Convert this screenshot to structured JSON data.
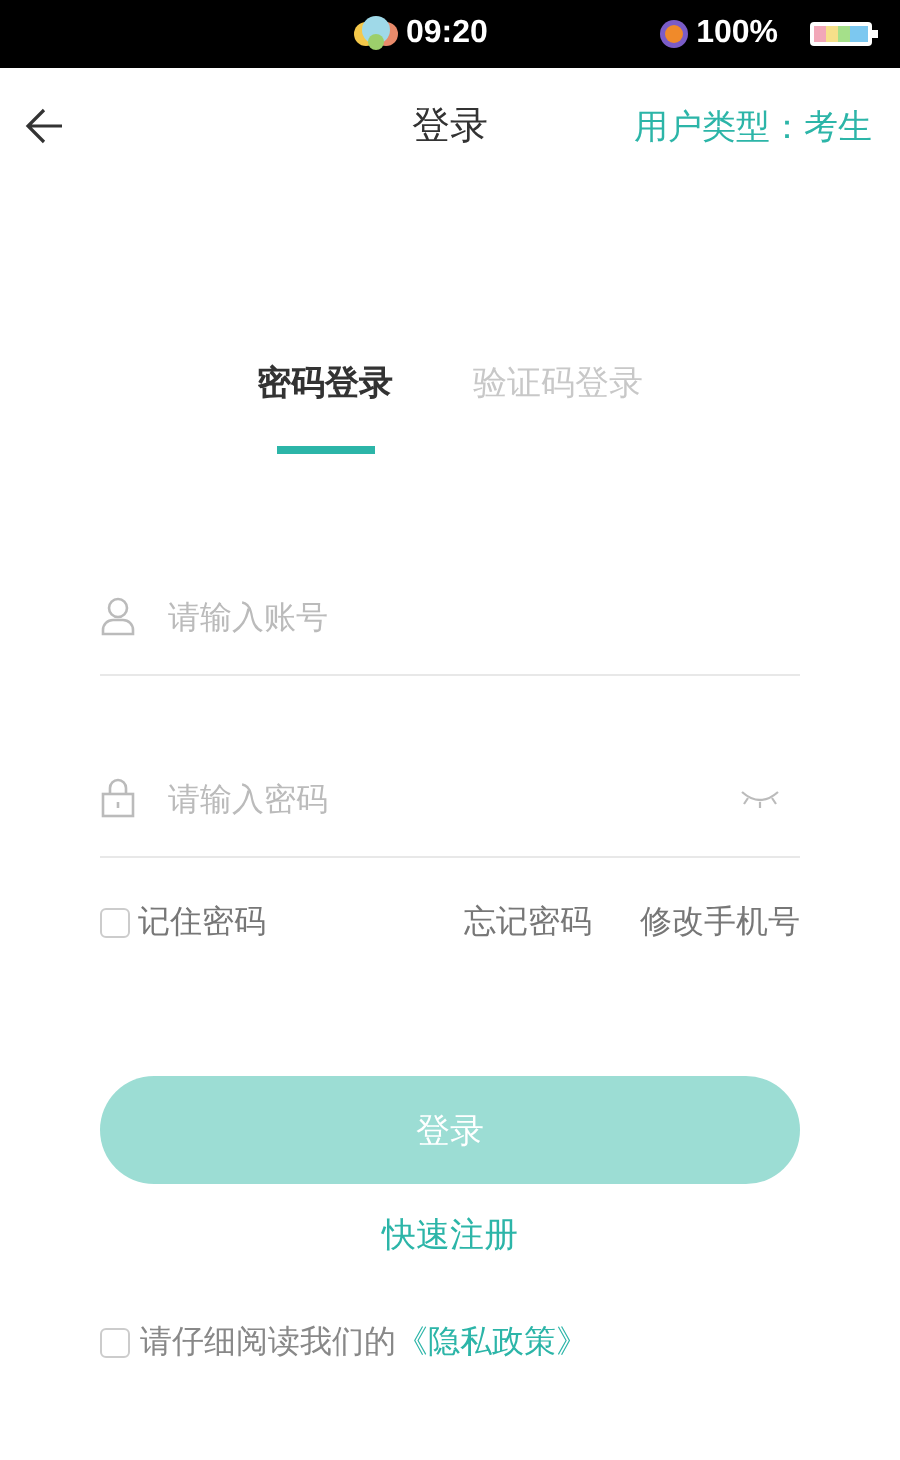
{
  "status_bar": {
    "time": "09:20",
    "battery": "100%"
  },
  "header": {
    "title": "登录",
    "user_type": "用户类型：考生"
  },
  "tabs": [
    {
      "label": "密码登录",
      "selected": true
    },
    {
      "label": "验证码登录",
      "selected": false
    }
  ],
  "fields": [
    {
      "kind": "account",
      "placeholder": "请输入账号"
    },
    {
      "kind": "password",
      "placeholder": "请输入密码"
    }
  ],
  "remember": {
    "label": "记住密码",
    "checked": false
  },
  "links": [
    "忘记密码",
    "修改手机号"
  ],
  "login_button": {
    "label": "登录",
    "disabled": true
  },
  "register_link": "快速注册",
  "agreement": {
    "checked": false,
    "text": "请仔细阅读我们的",
    "link": "《隐私政策》"
  }
}
